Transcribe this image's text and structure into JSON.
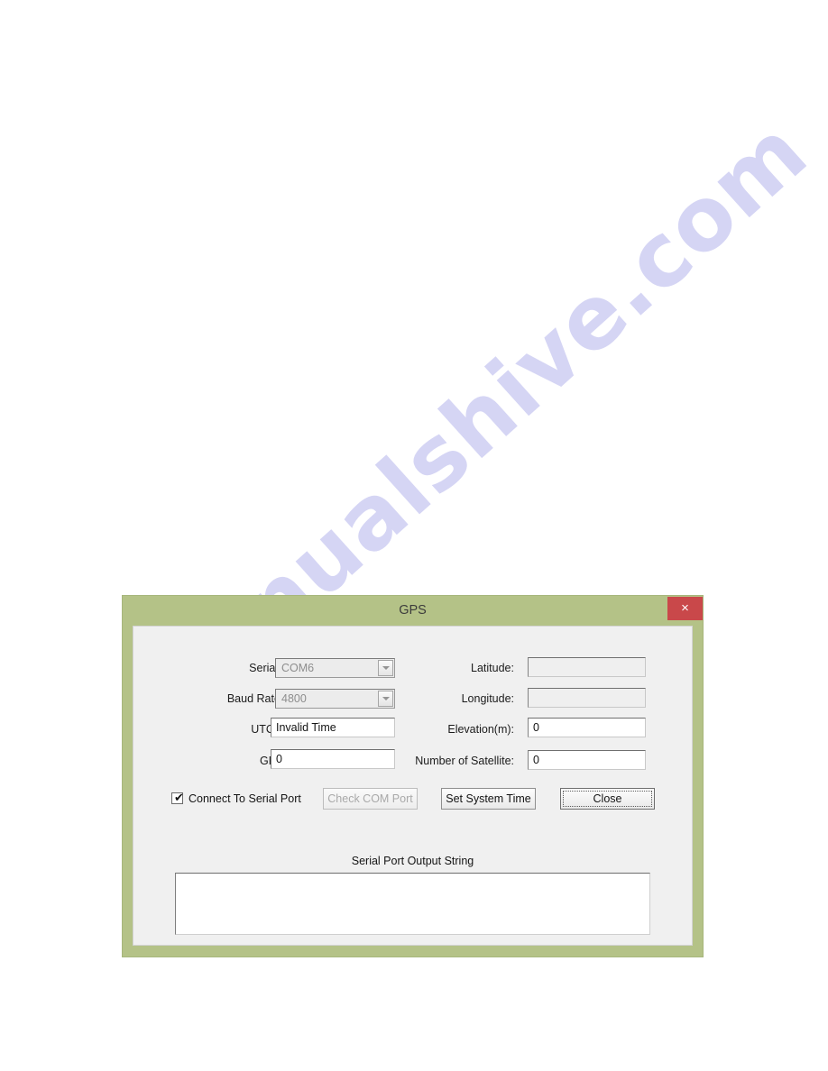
{
  "page": {
    "watermark_text": "manualshive.com",
    "background_color": "#ffffff"
  },
  "dialog": {
    "title": "GPS",
    "titlebar_color": "#b4c287",
    "close_button": {
      "label": "×",
      "color": "#c9484a",
      "name": "close-window"
    },
    "panel_color": "#f0f0f0",
    "left_fields": [
      {
        "label": "Serial Port:",
        "type": "combobox",
        "value": "COM6",
        "disabled": true,
        "name": "serial-port"
      },
      {
        "label": "Baud Rate(Hz):",
        "type": "combobox",
        "value": "4800",
        "disabled": true,
        "name": "baud-rate"
      },
      {
        "label": "UTC Time:",
        "type": "text",
        "value": "Invalid Time",
        "disabled": false,
        "name": "utc-time"
      },
      {
        "label": "GPS Fix:",
        "type": "text",
        "value": "0",
        "disabled": false,
        "name": "gps-fix"
      }
    ],
    "right_fields": [
      {
        "label": "Latitude:",
        "type": "text",
        "value": "",
        "disabled": true,
        "name": "latitude"
      },
      {
        "label": "Longitude:",
        "type": "text",
        "value": "",
        "disabled": true,
        "name": "longitude"
      },
      {
        "label": "Elevation(m):",
        "type": "text",
        "value": "0",
        "disabled": false,
        "name": "elevation"
      },
      {
        "label": "Number of Satellite:",
        "type": "text",
        "value": "0",
        "disabled": false,
        "name": "number-of-satellite"
      }
    ],
    "connect_checkbox": {
      "label": "Connect To Serial Port",
      "checked": true,
      "mark": "✔"
    },
    "buttons": [
      {
        "label": "Check COM Port",
        "disabled": true,
        "focused": false,
        "name": "check-com-port"
      },
      {
        "label": "Set System Time",
        "disabled": false,
        "focused": false,
        "name": "set-system-time"
      },
      {
        "label": "Close",
        "disabled": false,
        "focused": true,
        "name": "close"
      }
    ],
    "output_section": {
      "caption": "Serial Port Output String",
      "content": ""
    }
  }
}
